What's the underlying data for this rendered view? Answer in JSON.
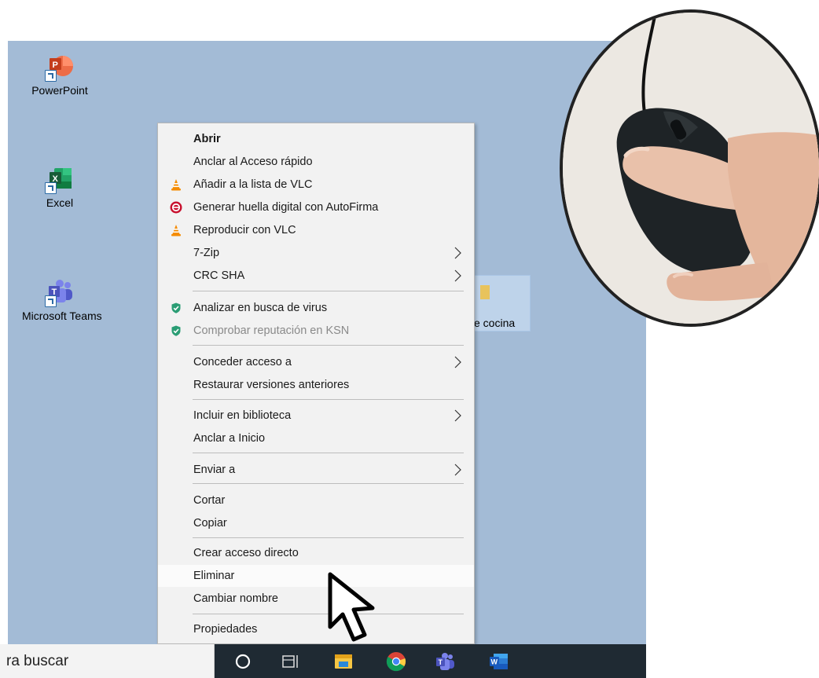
{
  "desktop": {
    "background": "#a3bbd6",
    "icons": [
      {
        "label": "PowerPoint",
        "icon": "powerpoint-icon",
        "color": "#d24726"
      },
      {
        "label": "Excel",
        "icon": "excel-icon",
        "color": "#1d6f42"
      },
      {
        "label": "Microsoft Teams",
        "icon": "teams-icon",
        "color": "#5059c9"
      }
    ],
    "selected_folder": {
      "label": "e cocina",
      "icon": "folder-icon"
    }
  },
  "context_menu": {
    "items": [
      {
        "label": "Abrir",
        "bold": true
      },
      {
        "label": "Anclar al Acceso rápido"
      },
      {
        "label": "Añadir a la lista de VLC",
        "icon": "vlc-icon"
      },
      {
        "label": "Generar huella digital con AutoFirma",
        "icon": "autofirma-icon"
      },
      {
        "label": "Reproducir con VLC",
        "icon": "vlc-icon"
      },
      {
        "label": "7-Zip",
        "submenu": true
      },
      {
        "label": "CRC SHA",
        "submenu": true
      },
      {
        "label": "Analizar en busca de virus",
        "icon": "kaspersky-shield-icon"
      },
      {
        "label": "Comprobar reputación en KSN",
        "icon": "kaspersky-shield-icon",
        "disabled": true
      },
      {
        "label": "Conceder acceso a",
        "submenu": true
      },
      {
        "label": "Restaurar versiones anteriores"
      },
      {
        "label": "Incluir en biblioteca",
        "submenu": true
      },
      {
        "label": "Anclar a Inicio"
      },
      {
        "label": "Enviar a",
        "submenu": true
      },
      {
        "label": "Cortar"
      },
      {
        "label": "Copiar"
      },
      {
        "label": "Crear acceso directo"
      },
      {
        "label": "Eliminar",
        "highlighted": true
      },
      {
        "label": "Cambiar nombre"
      },
      {
        "label": "Propiedades"
      }
    ]
  },
  "taskbar": {
    "search_text": "ra buscar",
    "icons": [
      "cortana-circle-icon",
      "task-view-icon",
      "file-explorer-icon",
      "chrome-icon",
      "teams-icon",
      "word-icon"
    ]
  },
  "magnifier": {
    "description_icon": "mouse-hand-icon"
  },
  "colors": {
    "menu_bg": "#f2f2f2",
    "taskbar": "#1f2a33",
    "highlight": "#fbfbfb"
  }
}
